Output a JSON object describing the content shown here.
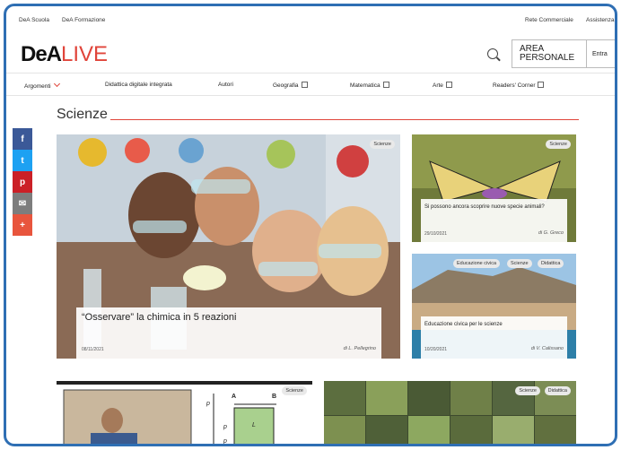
{
  "topbar": {
    "left1": "DeA Scuola",
    "left2": "DeA Formazione",
    "right1": "Rete Commerciale",
    "right2": "Assistenza"
  },
  "header": {
    "logo_dea": "DeA",
    "logo_live": "LIVE",
    "area_line1": "AREA",
    "area_line2": "PERSONALE",
    "entra": "Entra"
  },
  "nav": {
    "argomenti": "Argomenti",
    "items": [
      "Didattica digitale integrata",
      "Autori",
      "Geografia",
      "Matematica",
      "Arte",
      "Readers' Corner"
    ]
  },
  "section": {
    "title": "Scienze"
  },
  "social": [
    "f",
    "t",
    "p",
    "✉",
    "+"
  ],
  "main_article": {
    "tag": "Scienze",
    "title": "“Osservare” la chimica in 5 reazioni",
    "date": "08/11/2021",
    "author": "di L. Pellegrino"
  },
  "side_article_1": {
    "tag": "Scienze",
    "title": "Si possono ancora scoprire nuove specie animali?",
    "date": "29/10/2021",
    "author": "di G. Greco"
  },
  "side_article_2": {
    "tags": [
      "Educazione civica",
      "Scienze",
      "Didattica"
    ],
    "title": "Educazione civica per le scienze",
    "date": "10/20/2021",
    "author": "di V. Calissano"
  },
  "bottom_article_1": {
    "tag": "Scienze",
    "diagram_labels": [
      "p",
      "A",
      "B",
      "p",
      "L",
      "p"
    ]
  },
  "bottom_article_2": {
    "tags": [
      "Scienze",
      "Didattica"
    ]
  },
  "colors": {
    "accent": "#e0443a",
    "frame": "#2f6fb4",
    "facebook": "#3b5998",
    "twitter": "#1da1f2",
    "pinterest": "#cb2027",
    "mail": "#7d7d7d",
    "more": "#e8553d"
  }
}
